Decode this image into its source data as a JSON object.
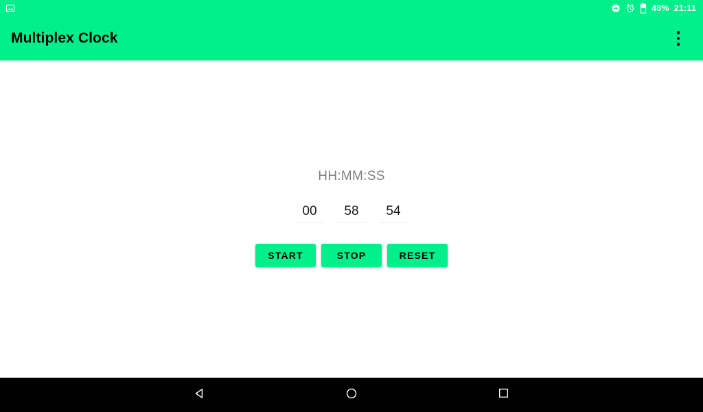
{
  "status_bar": {
    "background_color": "#00EF8B",
    "left_icons": [
      {
        "name": "screenshot-notification-icon",
        "glyph": "image"
      }
    ],
    "right_icons": [
      {
        "name": "do-not-disturb-icon",
        "glyph": "minus-circle"
      },
      {
        "name": "alarm-clock-icon",
        "glyph": "alarm"
      },
      {
        "name": "battery-icon",
        "glyph": "battery",
        "level_percent": 48
      }
    ],
    "battery_percent_label": "48%",
    "clock_label": "21:11"
  },
  "app_bar": {
    "title": "Multiplex Clock",
    "background_color": "#00EF8B",
    "title_color": "#000000",
    "overflow_menu_name": "overflow-menu-button"
  },
  "main": {
    "format_label": "HH:MM:SS",
    "format_label_color": "#808080",
    "time_fields": [
      {
        "name": "hours-field",
        "value": "00"
      },
      {
        "name": "minutes-field",
        "value": "58"
      },
      {
        "name": "seconds-field",
        "value": "54"
      }
    ],
    "buttons": [
      {
        "name": "start-button",
        "label": "START"
      },
      {
        "name": "stop-button",
        "label": "STOP"
      },
      {
        "name": "reset-button",
        "label": "RESET"
      }
    ],
    "accent_color": "#00EF8B",
    "background_color": "#FFFFFF"
  },
  "nav_bar": {
    "background_color": "#000000",
    "buttons": [
      {
        "name": "nav-back-button",
        "glyph": "triangle-left"
      },
      {
        "name": "nav-home-button",
        "glyph": "circle"
      },
      {
        "name": "nav-recents-button",
        "glyph": "square"
      }
    ]
  }
}
